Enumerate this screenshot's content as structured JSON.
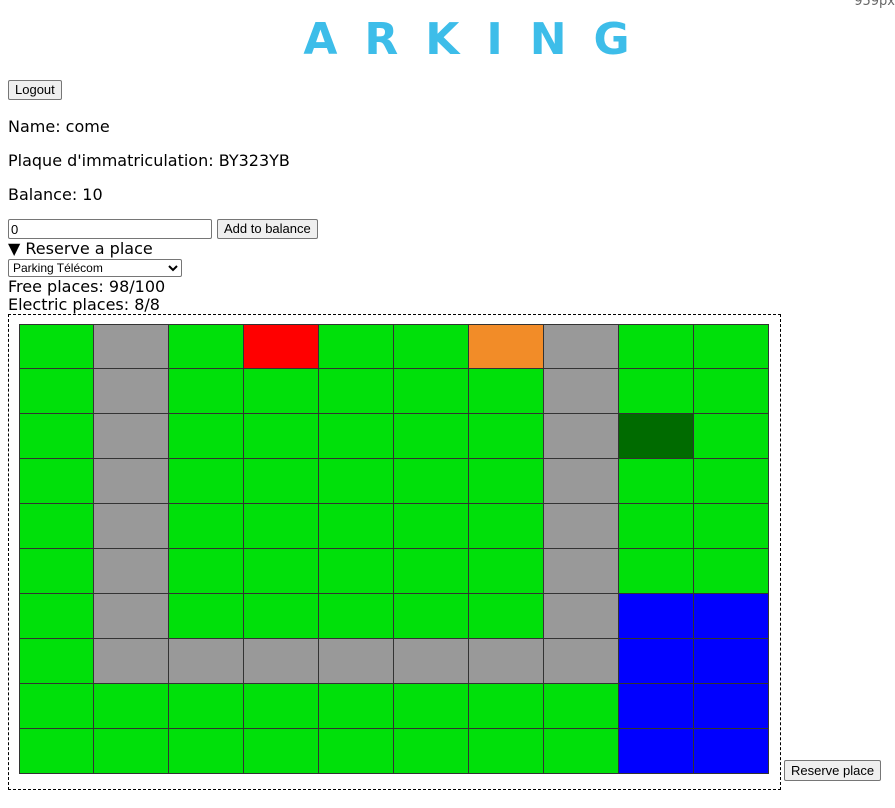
{
  "corner_text": "959px",
  "logo": "ARKING",
  "logout_label": "Logout",
  "profile": {
    "name_line": "Name: come",
    "plate_line": "Plaque d'immatriculation: BY323YB",
    "balance_line": "Balance: 10"
  },
  "balance_form": {
    "input_value": "0",
    "add_label": "Add to balance"
  },
  "reserve": {
    "summary": "▼ Reserve a place",
    "selected_parking": "Parking Télécom",
    "free_places": "Free places: 98/100",
    "electric_places": "Electric places: 8/8",
    "button_label": "Reserve place"
  },
  "cell_colors": {
    "F": "#00e00a",
    "R": "#999999",
    "X": "#ff0000",
    "O": "#f28c28",
    "S": "#006b00",
    "E": "#0000ff"
  },
  "map_grid": [
    "FRFXFFORFF",
    "FRFFFFFRFF",
    "FRFFFFFRSF",
    "FRFFFFFRFF",
    "FRFFFFFRFF",
    "FRFFFFFRFF",
    "FRFFFFFREE",
    "FRRRRRRREE",
    "FFFFFFFFEE",
    "FFFFFFFFEE"
  ]
}
